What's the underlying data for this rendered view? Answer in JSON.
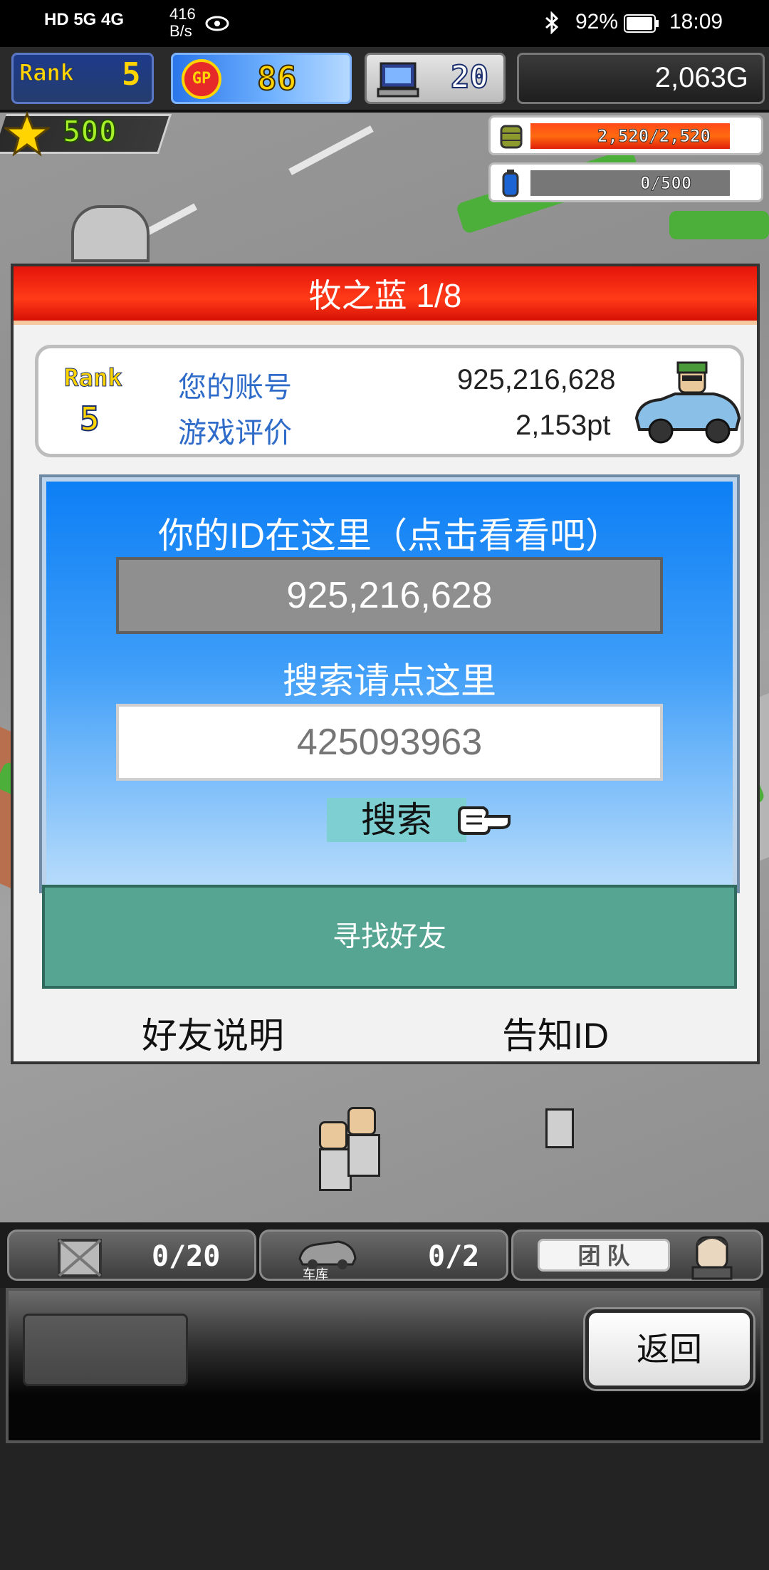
{
  "status_bar": {
    "left_icons": "HD 5G 4G",
    "net_speed_value": "416",
    "net_speed_unit": "B/s",
    "battery_percent": "92%",
    "time": "18:09"
  },
  "hud": {
    "rank_label": "Rank",
    "rank_value": "5",
    "gp_label": "GP",
    "gp_value": "86",
    "pc_value": "20",
    "gold": "2,063G",
    "star_value": "500",
    "bar1_value": "2,520/2,520",
    "bar1_fill_pct": 100,
    "bar2_value": "0/500",
    "bar2_fill_pct": 0
  },
  "dialog": {
    "title": "牧之蓝 1/8",
    "card": {
      "rank_label": "Rank",
      "rank_value": "5",
      "account_label": "您的账号",
      "account_value": "925,216,628",
      "rating_label": "游戏评价",
      "rating_value": "2,153pt"
    },
    "id_panel": {
      "heading": "你的ID在这里（点击看看吧）",
      "my_id": "925,216,628",
      "search_heading": "搜索请点这里",
      "search_placeholder": "425093963",
      "search_button": "搜索"
    },
    "find_friend": "寻找好友",
    "friend_help": "好友说明",
    "notify_id": "告知ID"
  },
  "bottom": {
    "box_count": "0/20",
    "garage_count": "0/2",
    "garage_label": "车库",
    "team_label": "团 队",
    "back_button": "返回"
  },
  "colors": {
    "title_red": "#e4140a",
    "panel_blue": "#0d7ff5",
    "find_friend_green": "#56a592"
  }
}
